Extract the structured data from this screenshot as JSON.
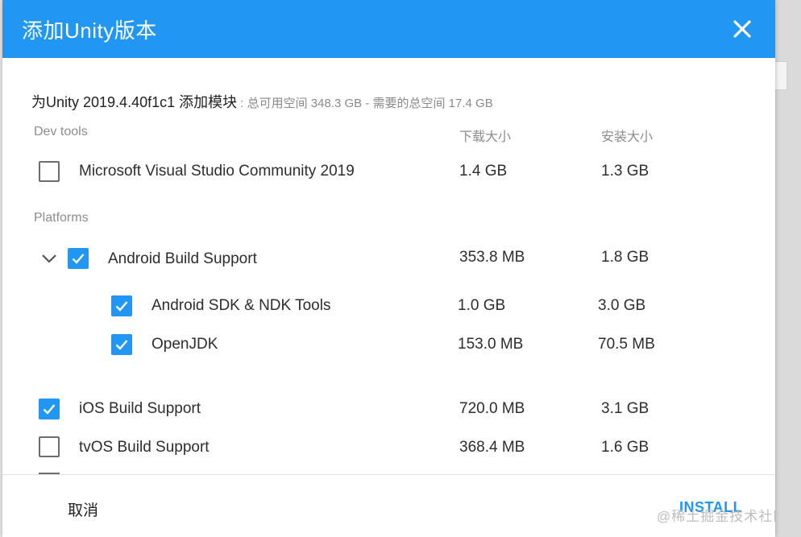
{
  "dialog": {
    "title": "添加Unity版本",
    "summary": "为Unity 2019.4.40f1c1 添加模块",
    "summary_meta": " : 总可用空间 348.3 GB - 需要的总空间 17.4 GB"
  },
  "columns": {
    "download": "下载大小",
    "install": "安装大小"
  },
  "sections": {
    "dev_tools": "Dev tools",
    "platforms": "Platforms"
  },
  "modules": {
    "vs": {
      "label": "Microsoft Visual Studio Community 2019",
      "download": "1.4 GB",
      "install": "1.3 GB",
      "checked": false
    },
    "android": {
      "label": "Android Build Support",
      "download": "353.8 MB",
      "install": "1.8 GB",
      "checked": true,
      "expanded": true
    },
    "android_sdk": {
      "label": "Android SDK & NDK Tools",
      "download": "1.0 GB",
      "install": "3.0 GB",
      "checked": true
    },
    "openjdk": {
      "label": "OpenJDK",
      "download": "153.0 MB",
      "install": "70.5 MB",
      "checked": true
    },
    "ios": {
      "label": "iOS Build Support",
      "download": "720.0 MB",
      "install": "3.1 GB",
      "checked": true
    },
    "tvos": {
      "label": "tvOS Build Support",
      "download": "368.4 MB",
      "install": "1.6 GB",
      "checked": false
    }
  },
  "footer": {
    "cancel": "取消",
    "install": "INSTALL"
  },
  "watermark": "@稀土掘金技术社区",
  "colors": {
    "accent": "#2196f3",
    "text": "#2d2d2d",
    "muted": "#8d8d8d"
  },
  "icons": {
    "close": "close-icon",
    "expand": "chevron-down-icon",
    "check": "checkmark-icon"
  }
}
